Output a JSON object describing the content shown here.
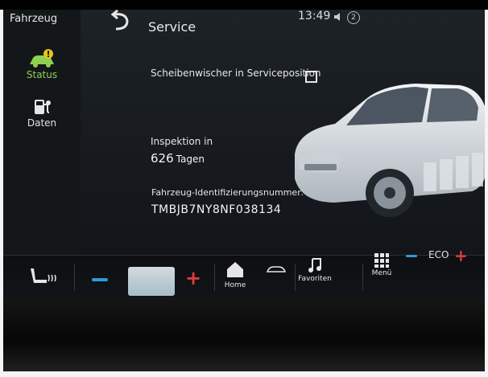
{
  "sidebar": {
    "title": "Fahrzeug",
    "items": [
      {
        "label": "Status",
        "icon": "car-warning-icon",
        "active": true
      },
      {
        "label": "Daten",
        "icon": "fuel-data-icon",
        "active": false
      }
    ]
  },
  "header": {
    "title": "Service",
    "clock": "13:49",
    "notification_count": "2"
  },
  "service": {
    "wiper_label": "Scheibenwischer in Serviceposition",
    "wiper_checked": false,
    "inspection_label": "Inspektion in",
    "inspection_value": "626",
    "inspection_unit": "Tagen",
    "vin_label": "Fahrzeug-Identifizierungsnummer:",
    "vin_value": "TMBJB7NY8NF038134"
  },
  "bar": {
    "home_label": "Home",
    "favorites_label": "Favoriten",
    "menu_label": "Menü",
    "eco_label": "ECO"
  },
  "colors": {
    "accent_green": "#8fd14f",
    "minus_blue": "#2e9bd6",
    "plus_red": "#e23b3b"
  }
}
